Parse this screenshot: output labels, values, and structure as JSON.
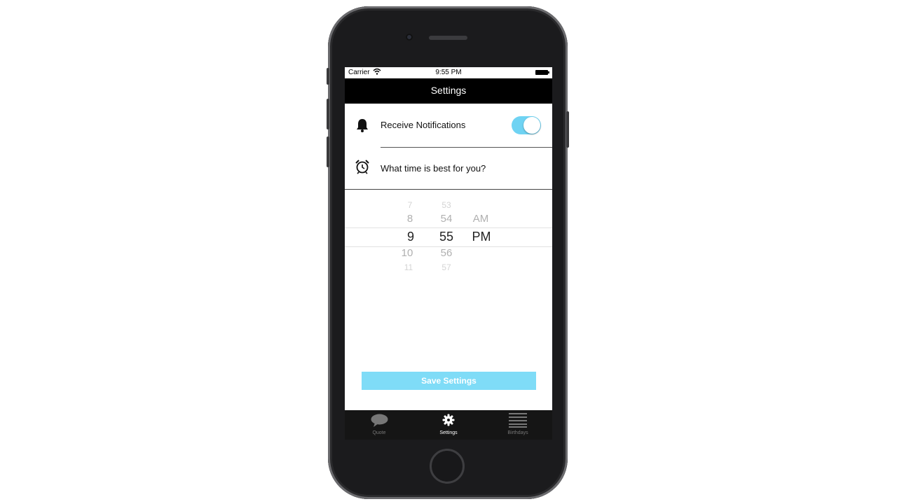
{
  "status_bar": {
    "carrier": "Carrier",
    "time": "9:55 PM"
  },
  "nav": {
    "title": "Settings"
  },
  "notifications": {
    "label": "Receive Notifications",
    "icon": "bell-icon",
    "toggle_on": true
  },
  "time_question": {
    "label": "What time is best for you?",
    "icon": "alarm-clock-icon"
  },
  "picker": {
    "hours": [
      "7",
      "8",
      "9",
      "10",
      "11"
    ],
    "minutes": [
      "53",
      "54",
      "55",
      "56",
      "57"
    ],
    "periods": [
      "AM",
      "PM"
    ],
    "selected": {
      "hour": "9",
      "minute": "55",
      "period": "PM"
    }
  },
  "save_button": {
    "label": "Save Settings"
  },
  "tabs": [
    {
      "label": "Quote",
      "icon": "speech-bubble-icon",
      "active": false
    },
    {
      "label": "Settings",
      "icon": "gear-icon",
      "active": true
    },
    {
      "label": "Birthdays",
      "icon": "list-icon",
      "active": false
    }
  ],
  "colors": {
    "accent": "#6fd3f3",
    "button": "#7fdcf7",
    "nav_background": "#000000",
    "tab_background": "#151515"
  }
}
